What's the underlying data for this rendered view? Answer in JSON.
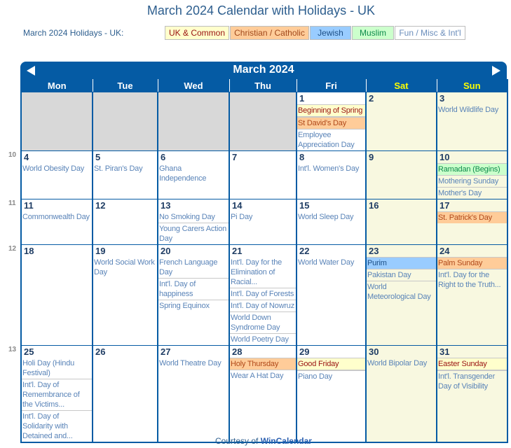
{
  "page": {
    "title": "March 2024 Calendar with Holidays - UK"
  },
  "legend": {
    "label": "March 2024 Holidays - UK:",
    "items": [
      {
        "label": "UK & Common",
        "color": "#ffffcc"
      },
      {
        "label": "Christian / Catholic",
        "color": "#ffcc99"
      },
      {
        "label": "Jewish",
        "color": "#99ccff"
      },
      {
        "label": "Muslim",
        "color": "#ccffcc"
      },
      {
        "label": "Fun / Misc & Int'l",
        "color": "#ffffff"
      }
    ]
  },
  "calendar": {
    "month_label": "March 2024",
    "prev_icon": "left-triangle-arrow",
    "next_icon": "right-triangle-arrow",
    "day_headers": [
      "Mon",
      "Tue",
      "Wed",
      "Thu",
      "Fri",
      "Sat",
      "Sun"
    ],
    "week_numbers": [
      "10",
      "11",
      "12",
      "13"
    ],
    "weeks": [
      {
        "days": [
          {
            "num": "",
            "events": []
          },
          {
            "num": "",
            "events": []
          },
          {
            "num": "",
            "events": []
          },
          {
            "num": "",
            "events": []
          },
          {
            "num": "1",
            "events": [
              {
                "text": "Beginning of Spring",
                "type": "uk"
              },
              {
                "text": "St David's Day",
                "type": "chr"
              },
              {
                "text": "Employee Appreciation Day",
                "type": "fun"
              }
            ]
          },
          {
            "num": "2",
            "events": []
          },
          {
            "num": "3",
            "events": [
              {
                "text": "World Wildlife Day",
                "type": "fun"
              }
            ]
          }
        ]
      },
      {
        "days": [
          {
            "num": "4",
            "events": [
              {
                "text": "World Obesity Day",
                "type": "fun"
              }
            ]
          },
          {
            "num": "5",
            "events": [
              {
                "text": "St. Piran's Day",
                "type": "fun"
              }
            ]
          },
          {
            "num": "6",
            "events": [
              {
                "text": "Ghana Independence",
                "type": "fun"
              }
            ]
          },
          {
            "num": "7",
            "events": []
          },
          {
            "num": "8",
            "events": [
              {
                "text": "Int'l. Women's Day",
                "type": "fun"
              }
            ]
          },
          {
            "num": "9",
            "events": []
          },
          {
            "num": "10",
            "events": [
              {
                "text": "Ramadan (Begins)",
                "type": "mus"
              },
              {
                "text": "Mothering Sunday",
                "type": "fun"
              },
              {
                "text": "Mother's Day",
                "type": "fun"
              }
            ]
          }
        ]
      },
      {
        "days": [
          {
            "num": "11",
            "events": [
              {
                "text": "Commonwealth Day",
                "type": "fun"
              }
            ]
          },
          {
            "num": "12",
            "events": []
          },
          {
            "num": "13",
            "events": [
              {
                "text": "No Smoking Day",
                "type": "fun"
              },
              {
                "text": "Young Carers Action Day",
                "type": "fun"
              }
            ]
          },
          {
            "num": "14",
            "events": [
              {
                "text": "Pi Day",
                "type": "fun"
              }
            ]
          },
          {
            "num": "15",
            "events": [
              {
                "text": "World Sleep Day",
                "type": "fun"
              }
            ]
          },
          {
            "num": "16",
            "events": []
          },
          {
            "num": "17",
            "events": [
              {
                "text": "St. Patrick's Day",
                "type": "chr"
              }
            ]
          }
        ]
      },
      {
        "days": [
          {
            "num": "18",
            "events": []
          },
          {
            "num": "19",
            "events": [
              {
                "text": "World Social Work Day",
                "type": "fun"
              }
            ]
          },
          {
            "num": "20",
            "events": [
              {
                "text": "French Language Day",
                "type": "fun"
              },
              {
                "text": "Int'l. Day of happiness",
                "type": "fun"
              },
              {
                "text": "Spring Equinox",
                "type": "fun"
              }
            ]
          },
          {
            "num": "21",
            "events": [
              {
                "text": "Int'l. Day for the Elimination of Racial...",
                "type": "fun"
              },
              {
                "text": "Int'l. Day of Forests",
                "type": "fun"
              },
              {
                "text": "Int'l. Day of Nowruz",
                "type": "fun"
              },
              {
                "text": "World Down Syndrome Day",
                "type": "fun"
              },
              {
                "text": "World Poetry Day",
                "type": "fun"
              }
            ]
          },
          {
            "num": "22",
            "events": [
              {
                "text": "World Water Day",
                "type": "fun"
              }
            ]
          },
          {
            "num": "23",
            "events": [
              {
                "text": "Purim",
                "type": "jew"
              },
              {
                "text": "Pakistan Day",
                "type": "fun"
              },
              {
                "text": "World Meteorological Day",
                "type": "fun"
              }
            ]
          },
          {
            "num": "24",
            "events": [
              {
                "text": "Palm Sunday",
                "type": "chr"
              },
              {
                "text": "Int'l. Day for the Right to the Truth...",
                "type": "fun"
              }
            ]
          }
        ]
      },
      {
        "days": [
          {
            "num": "25",
            "events": [
              {
                "text": "Holi Day (Hindu Festival)",
                "type": "fun"
              },
              {
                "text": "Int'l. Day of Remembrance of the Victims...",
                "type": "fun"
              },
              {
                "text": "Int'l. Day of Solidarity with Detained and...",
                "type": "fun"
              }
            ]
          },
          {
            "num": "26",
            "events": []
          },
          {
            "num": "27",
            "events": [
              {
                "text": "World Theatre Day",
                "type": "fun"
              }
            ]
          },
          {
            "num": "28",
            "events": [
              {
                "text": "Holy Thursday",
                "type": "chr"
              },
              {
                "text": "Wear A Hat Day",
                "type": "fun"
              }
            ]
          },
          {
            "num": "29",
            "events": [
              {
                "text": "Good Friday",
                "type": "uk"
              },
              {
                "text": "Piano Day",
                "type": "fun"
              }
            ]
          },
          {
            "num": "30",
            "events": [
              {
                "text": "World Bipolar Day",
                "type": "fun"
              }
            ]
          },
          {
            "num": "31",
            "events": [
              {
                "text": "Easter Sunday",
                "type": "uk"
              },
              {
                "text": "Int'l. Transgender Day of Visibility",
                "type": "fun"
              }
            ]
          }
        ]
      }
    ]
  },
  "footer": {
    "prefix": "Courtesy of ",
    "link": "WinCalendar"
  }
}
